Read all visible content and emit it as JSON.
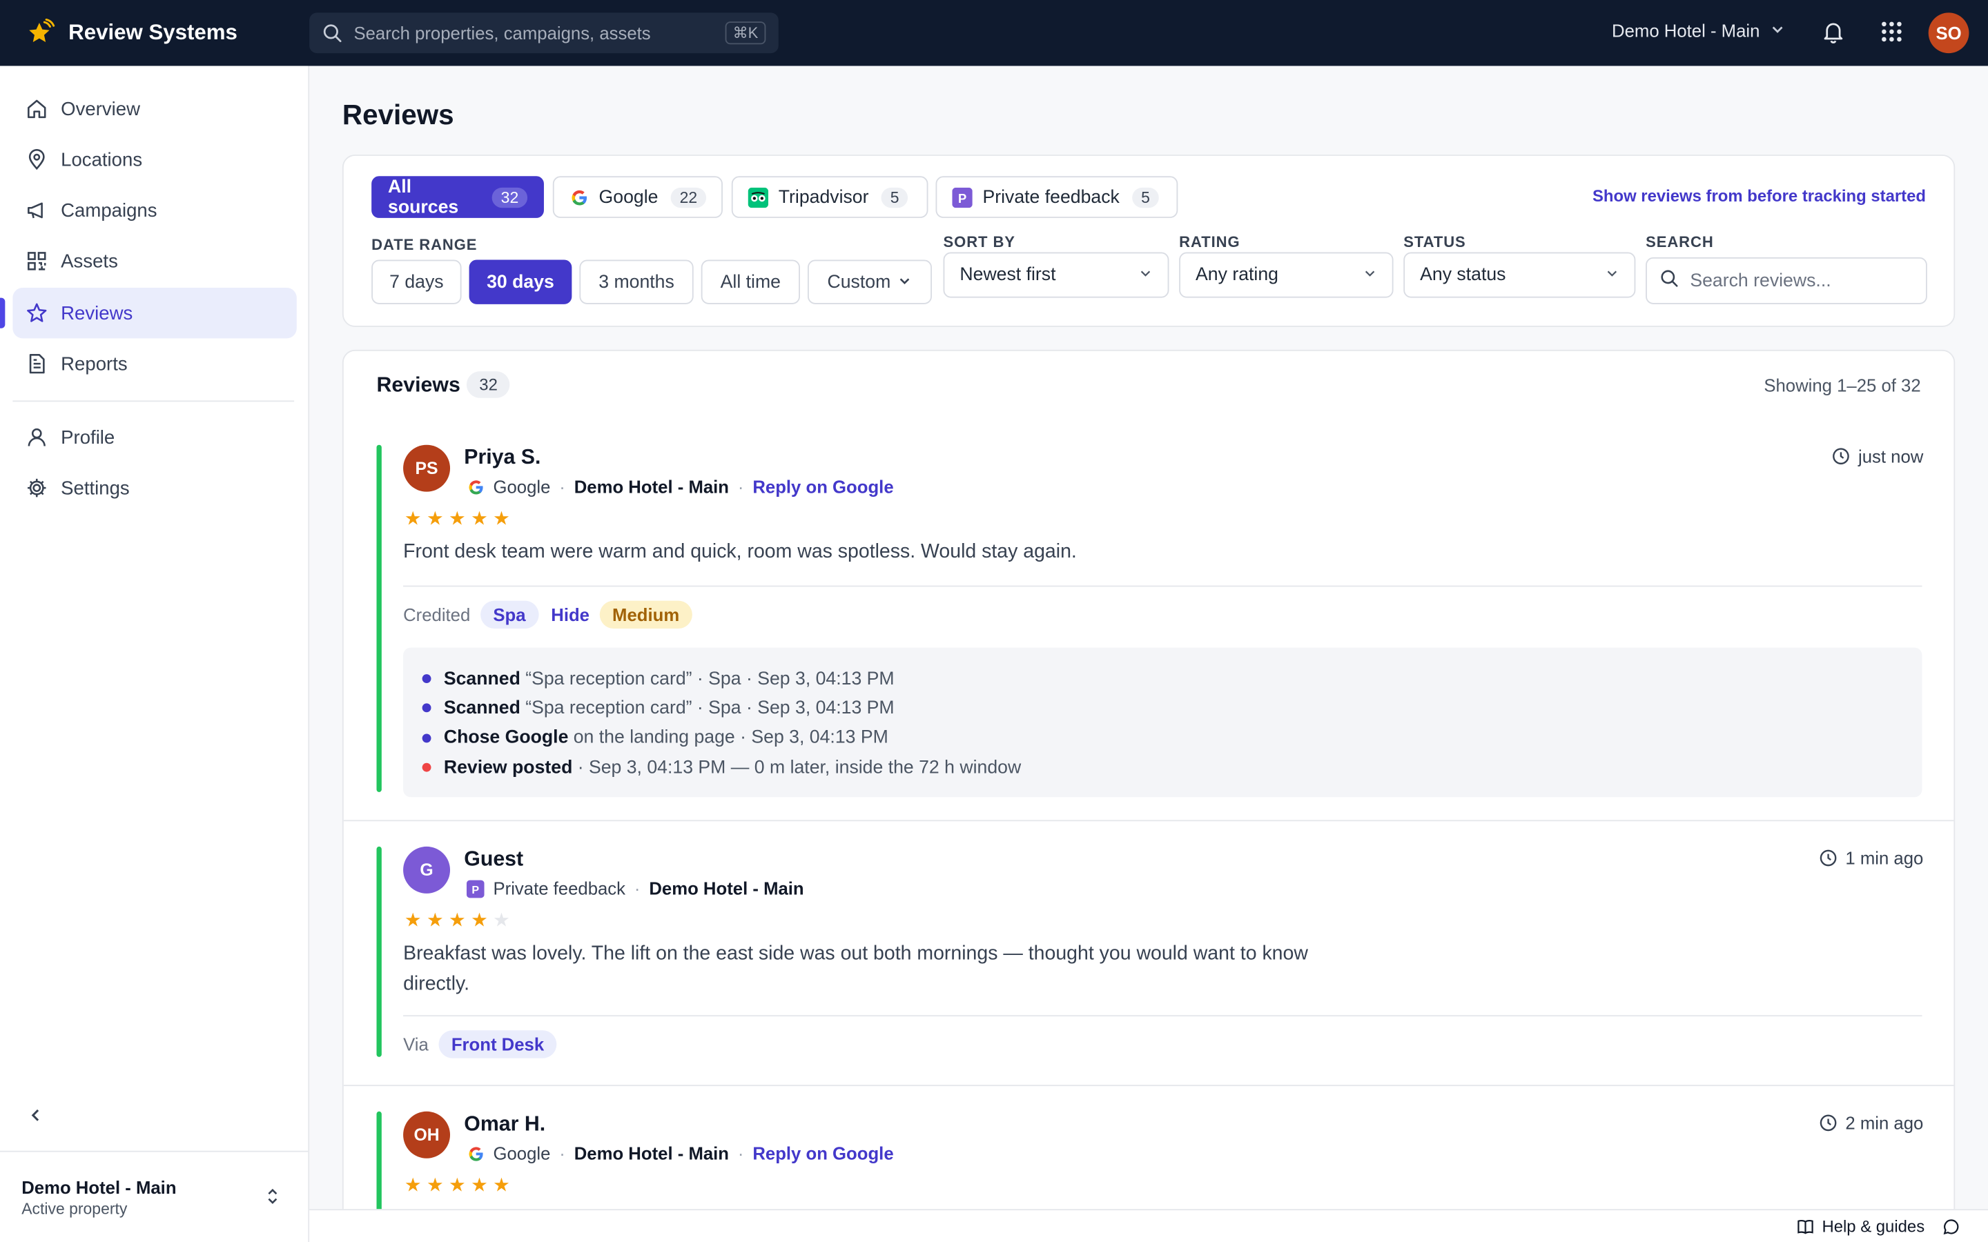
{
  "app": {
    "brand_name": "Review Systems",
    "search_placeholder": "Search properties, campaigns, assets",
    "search_shortcut": "⌘K",
    "property_switch": "Demo Hotel - Main",
    "user_initials": "SO",
    "accent": "#4338ca"
  },
  "sidebar": {
    "items": [
      {
        "label": "Overview",
        "icon": "home-icon"
      },
      {
        "label": "Locations",
        "icon": "map-pin-icon"
      },
      {
        "label": "Campaigns",
        "icon": "megaphone-icon"
      },
      {
        "label": "Assets",
        "icon": "qr-code-icon"
      },
      {
        "label": "Reviews",
        "icon": "star-icon",
        "active": true
      },
      {
        "label": "Reports",
        "icon": "document-icon"
      },
      {
        "label": "Profile",
        "icon": "user-icon"
      },
      {
        "label": "Settings",
        "icon": "gear-icon"
      }
    ],
    "footer_title": "Demo Hotel - Main",
    "footer_subtitle": "Active property"
  },
  "page": {
    "title": "Reviews"
  },
  "filters": {
    "sources": [
      {
        "label": "All sources",
        "count": "32",
        "active": true
      },
      {
        "label": "Google",
        "count": "22"
      },
      {
        "label": "Tripadvisor",
        "count": "5"
      },
      {
        "label": "Private feedback",
        "count": "5"
      }
    ],
    "show_before": "Show reviews from before tracking started",
    "date_range_label": "DATE RANGE",
    "date_ranges": [
      "7 days",
      "30 days",
      "3 months",
      "All time",
      "Custom"
    ],
    "date_range_selected": "30 days",
    "sort_label": "SORT BY",
    "sort_value": "Newest first",
    "rating_label": "RATING",
    "rating_value": "Any rating",
    "status_label": "STATUS",
    "status_value": "Any status",
    "search_label": "SEARCH",
    "search_placeholder": "Search reviews..."
  },
  "list": {
    "title": "Reviews",
    "count": "32",
    "showing": "Showing 1–25 of 32",
    "reviews": [
      {
        "initials": "PS",
        "avatar_color": "#b43e1a",
        "name": "Priya S.",
        "source": "Google",
        "location": "Demo Hotel - Main",
        "reply": "Reply on Google",
        "rating": 5,
        "time": "just now",
        "text": "Front desk team were warm and quick, room was spotless. Would stay again.",
        "tag_prefix": "Credited",
        "tag": "Spa",
        "hide": "Hide",
        "priority": "Medium",
        "journey": [
          {
            "action": "Scanned",
            "detail": "“Spa reception card” · Spa · Sep 3, 04:13 PM"
          },
          {
            "action": "Scanned",
            "detail": "“Spa reception card” · Spa · Sep 3, 04:13 PM"
          },
          {
            "action": "Chose Google",
            "detail": "on the landing page · Sep 3, 04:13 PM"
          },
          {
            "action": "Review posted",
            "detail": "· Sep 3, 04:13 PM — 0 m later, inside the 72 h window"
          }
        ]
      },
      {
        "initials": "G",
        "avatar_color": "#7c5ad6",
        "name": "Guest",
        "source": "Private feedback",
        "location": "Demo Hotel - Main",
        "rating": 4,
        "time": "1 min ago",
        "text": "Breakfast was lovely. The lift on the east side was out both mornings — thought you would want to know directly.",
        "tag_prefix": "Via",
        "tag": "Front Desk"
      },
      {
        "initials": "OH",
        "avatar_color": "#b43e1a",
        "name": "Omar H.",
        "source": "Google",
        "location": "Demo Hotel - Main",
        "reply": "Reply on Google",
        "rating": 5,
        "time": "2 min ago"
      }
    ]
  },
  "footer": {
    "help": "Help & guides"
  }
}
